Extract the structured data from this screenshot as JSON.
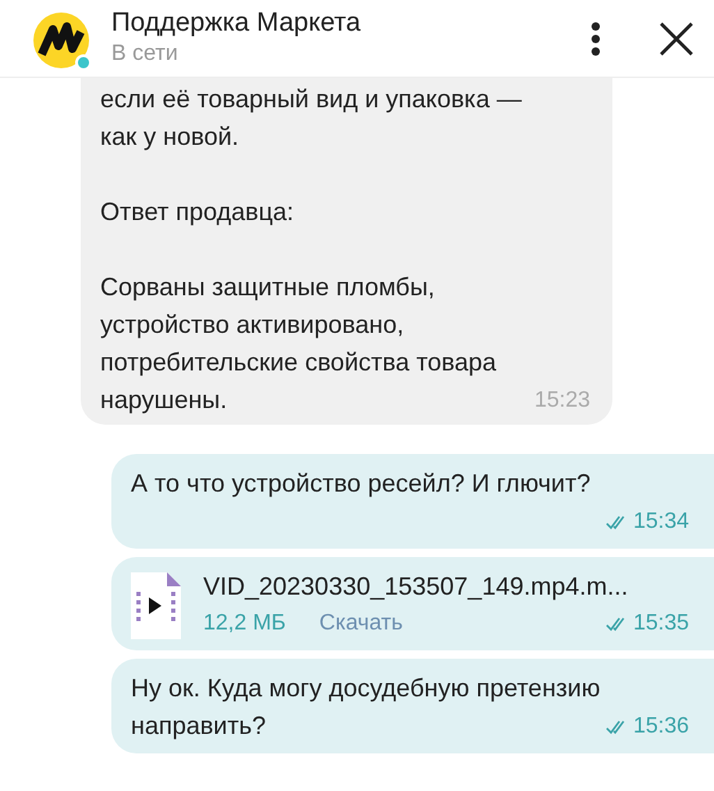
{
  "header": {
    "title": "Поддержка Маркета",
    "status": "В сети",
    "online": true
  },
  "messages": [
    {
      "kind": "text",
      "outgoing": false,
      "cut_top": true,
      "paragraphs": [
        "если её товарный вид и упаковка —\nкак у новой.",
        "Ответ продавца:",
        "Сорваны защитные пломбы,\nустройство активировано,\nпотребительские свойства товара\nнарушены."
      ],
      "time": "15:23"
    },
    {
      "kind": "text",
      "outgoing": true,
      "read": true,
      "paragraphs": [
        "А то что устройство ресейл? И глючит?"
      ],
      "time": "15:34"
    },
    {
      "kind": "file",
      "outgoing": true,
      "read": true,
      "filename": "VID_20230330_153507_149.mp4.m...",
      "size": "12,2 МБ",
      "action": "Скачать",
      "time": "15:35"
    },
    {
      "kind": "text",
      "outgoing": true,
      "read": true,
      "paragraphs": [
        "Ну ок. Куда могу досудебную претензию\nнаправить?"
      ],
      "time": "15:36"
    }
  ]
}
